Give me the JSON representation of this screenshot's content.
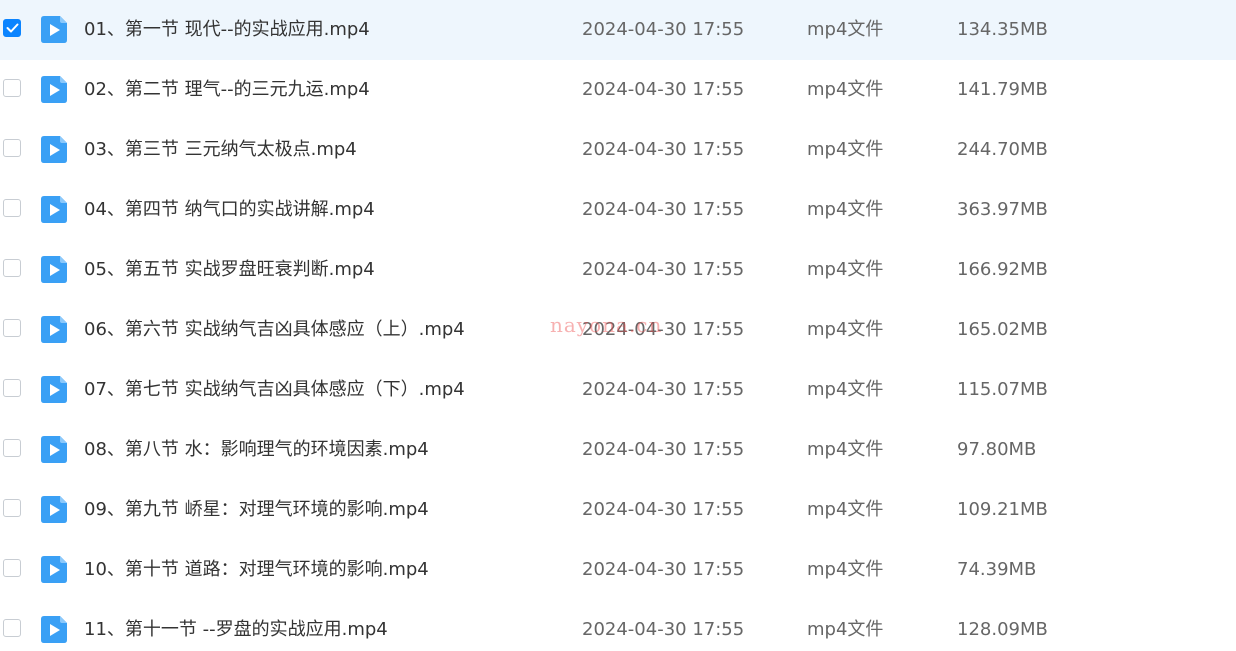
{
  "colors": {
    "accent": "#0b84ff",
    "selected_row_bg": "#eef6fd",
    "file_icon": "#3aa0f5",
    "watermark": "#eb4646"
  },
  "file_icon_name": "video-file-icon",
  "check_icon_name": "checkmark-icon",
  "files": [
    {
      "selected": true,
      "name": "01、第一节  现代--的实战应用.mp4",
      "date": "2024-04-30 17:55",
      "type": "mp4文件",
      "size": "134.35MB"
    },
    {
      "selected": false,
      "name": "02、第二节 理气--的三元九运.mp4",
      "date": "2024-04-30 17:55",
      "type": "mp4文件",
      "size": "141.79MB"
    },
    {
      "selected": false,
      "name": "03、第三节 三元纳气太极点.mp4",
      "date": "2024-04-30 17:55",
      "type": "mp4文件",
      "size": "244.70MB"
    },
    {
      "selected": false,
      "name": "04、第四节 纳气口的实战讲解.mp4",
      "date": "2024-04-30 17:55",
      "type": "mp4文件",
      "size": "363.97MB"
    },
    {
      "selected": false,
      "name": "05、第五节 实战罗盘旺衰判断.mp4",
      "date": "2024-04-30 17:55",
      "type": "mp4文件",
      "size": "166.92MB"
    },
    {
      "selected": false,
      "name": "06、第六节 实战纳气吉凶具体感应（上）.mp4",
      "date": "2024-04-30 17:55",
      "type": "mp4文件",
      "size": "165.02MB"
    },
    {
      "selected": false,
      "name": "07、第七节 实战纳气吉凶具体感应（下）.mp4",
      "date": "2024-04-30 17:55",
      "type": "mp4文件",
      "size": "115.07MB"
    },
    {
      "selected": false,
      "name": "08、第八节  水：影响理气的环境因素.mp4",
      "date": "2024-04-30 17:55",
      "type": "mp4文件",
      "size": "97.80MB"
    },
    {
      "selected": false,
      "name": "09、第九节  峤星：对理气环境的影响.mp4",
      "date": "2024-04-30 17:55",
      "type": "mp4文件",
      "size": "109.21MB"
    },
    {
      "selected": false,
      "name": "10、第十节  道路：对理气环境的影响.mp4",
      "date": "2024-04-30 17:55",
      "type": "mp4文件",
      "size": "74.39MB"
    },
    {
      "selected": false,
      "name": "11、第十一节  --罗盘的实战应用.mp4",
      "date": "2024-04-30 17:55",
      "type": "mp4文件",
      "size": "128.09MB"
    }
  ],
  "watermark_text": "nayona.cn"
}
